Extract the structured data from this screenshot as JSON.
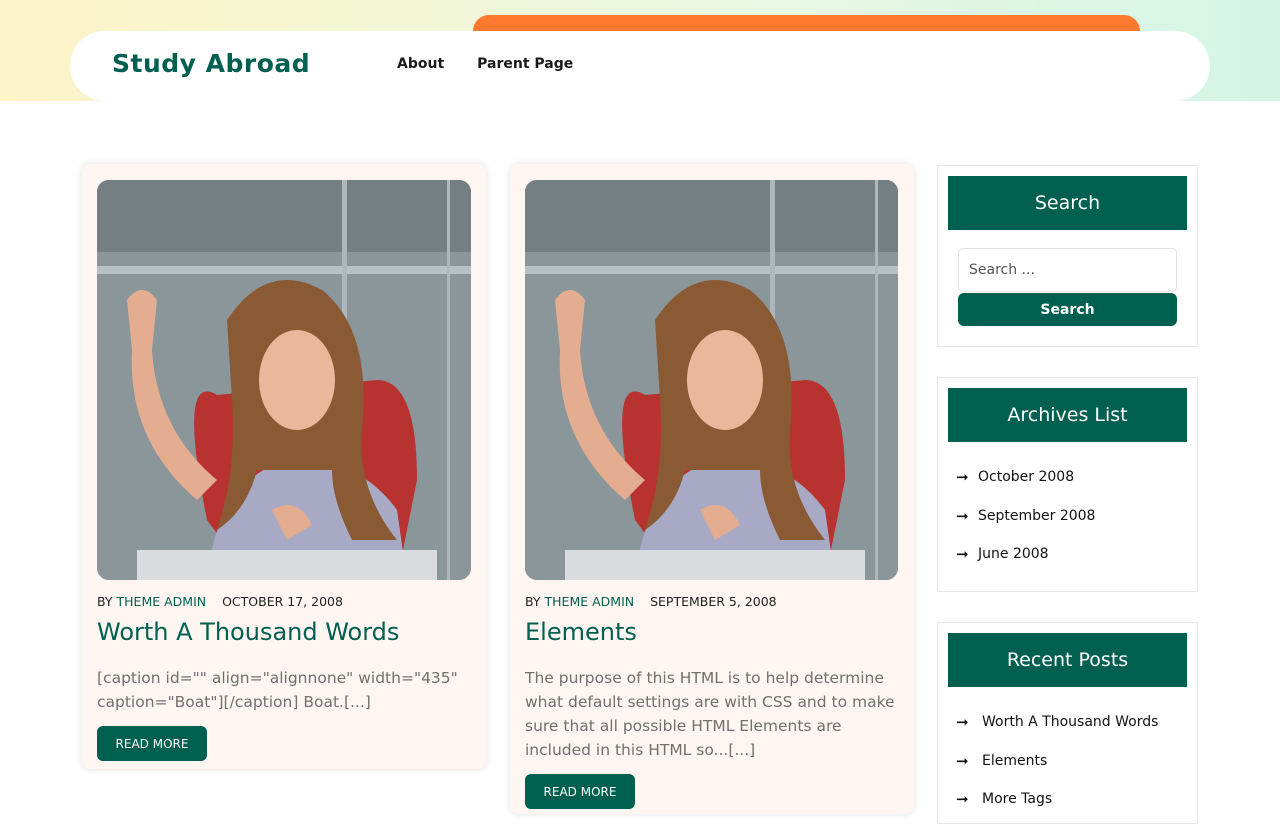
{
  "site": {
    "title": "Study Abroad"
  },
  "nav": {
    "items": [
      "About",
      "Parent Page"
    ]
  },
  "posts": [
    {
      "by": "BY",
      "author": "THEME ADMIN",
      "date": "OCTOBER 17, 2008",
      "title": "Worth A Thousand Words",
      "excerpt": "[caption id=\"\" align=\"alignnone\" width=\"435\" caption=\"Boat\"][/caption] Boat.[...]",
      "read_more": "READ MORE"
    },
    {
      "by": "BY",
      "author": "THEME ADMIN",
      "date": "SEPTEMBER 5, 2008",
      "title": "Elements",
      "excerpt": "The purpose of this HTML is to help determine what default settings are with CSS and to make sure that all possible HTML Elements are included in this HTML so...[...]",
      "read_more": "READ MORE"
    }
  ],
  "sidebar": {
    "search": {
      "title": "Search",
      "placeholder": "Search ...",
      "button": "Search"
    },
    "archives": {
      "title": "Archives List",
      "items": [
        "October 2008",
        "September 2008",
        "June 2008"
      ]
    },
    "recent": {
      "title": "Recent Posts",
      "items": [
        "Worth A Thousand Words",
        "Elements",
        "More Tags"
      ]
    }
  },
  "icons": {
    "list_bullet": "arrow-right-icon",
    "arrow_glyph": "➞"
  },
  "colors": {
    "brand": "#006050",
    "accent": "#ff7a2f",
    "card_bg": "#fff5f1"
  }
}
